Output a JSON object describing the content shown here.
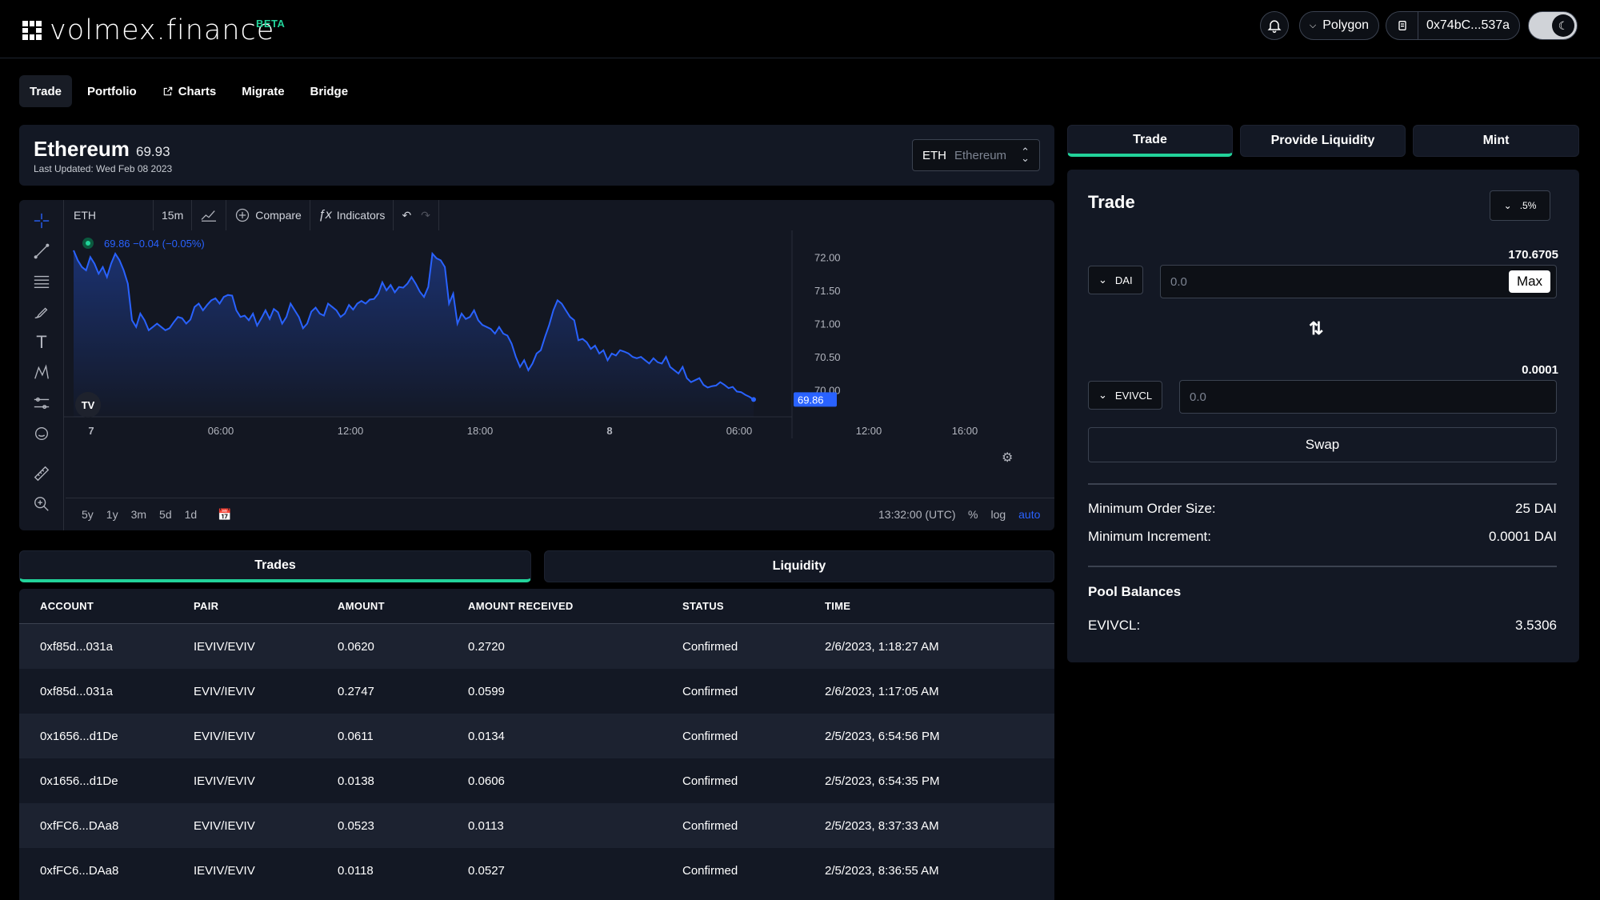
{
  "header": {
    "logo_text": "volmex.finance",
    "beta": "BETA",
    "network": "Polygon",
    "wallet": "0x74bC...537a"
  },
  "nav": [
    {
      "label": "Trade",
      "active": true
    },
    {
      "label": "Portfolio"
    },
    {
      "label": "Charts",
      "icon": "external-link-icon"
    },
    {
      "label": "Migrate"
    },
    {
      "label": "Bridge"
    }
  ],
  "asset": {
    "name": "Ethereum",
    "price": "69.93",
    "updated": "Last Updated: Wed Feb 08 2023",
    "select_symbol": "ETH",
    "select_name": "Ethereum"
  },
  "chart_toolbar": {
    "symbol": "ETH",
    "interval": "15m",
    "compare": "Compare",
    "indicators": "Indicators"
  },
  "chart_data": {
    "type": "area",
    "legend_value": "69.86",
    "legend_change": "−0.04 (−0.05%)",
    "last_label": "69.86",
    "x_ticks": [
      "7",
      "06:00",
      "12:00",
      "18:00",
      "8",
      "06:00",
      "12:00",
      "16:00"
    ],
    "y_ticks": [
      "72.00",
      "71.50",
      "71.00",
      "70.50",
      "70.00"
    ],
    "ylim": [
      69.6,
      72.4
    ],
    "values": [
      72.1,
      71.95,
      71.85,
      71.8,
      72.0,
      71.9,
      71.75,
      71.85,
      71.7,
      71.9,
      72.05,
      71.95,
      71.8,
      71.6,
      71.05,
      70.95,
      71.15,
      71.05,
      70.9,
      70.95,
      71.0,
      70.95,
      70.9,
      70.93,
      71.02,
      71.1,
      71.08,
      71.0,
      71.06,
      71.25,
      71.3,
      71.2,
      71.28,
      71.35,
      71.38,
      71.3,
      71.4,
      71.43,
      71.42,
      71.2,
      71.1,
      71.12,
      71.05,
      71.15,
      70.97,
      71.08,
      71.2,
      71.07,
      71.22,
      71.17,
      71.0,
      71.1,
      71.3,
      71.2,
      71.1,
      70.93,
      71.0,
      71.18,
      71.24,
      71.15,
      71.12,
      71.3,
      71.25,
      71.2,
      71.1,
      71.15,
      71.28,
      71.21,
      71.3,
      71.34,
      71.3,
      71.36,
      71.37,
      71.45,
      71.62,
      71.5,
      71.58,
      71.47,
      71.55,
      71.54,
      71.6,
      71.7,
      71.6,
      71.48,
      71.4,
      71.55,
      72.05,
      71.98,
      71.95,
      71.85,
      71.3,
      71.45,
      71.0,
      71.15,
      71.07,
      71.1,
      71.2,
      71.05,
      70.98,
      70.95,
      70.92,
      70.85,
      70.95,
      70.85,
      70.82,
      70.7,
      70.5,
      70.35,
      70.45,
      70.3,
      70.4,
      70.55,
      70.6,
      70.8,
      70.98,
      71.2,
      71.35,
      71.3,
      71.2,
      71.1,
      71.05,
      70.75,
      70.77,
      70.72,
      70.62,
      70.67,
      70.55,
      70.6,
      70.45,
      70.55,
      70.52,
      70.6,
      70.58,
      70.55,
      70.5,
      70.48,
      70.5,
      70.45,
      70.4,
      70.48,
      70.42,
      70.4,
      70.5,
      70.35,
      70.3,
      70.25,
      70.35,
      70.18,
      70.12,
      70.15,
      70.18,
      70.08,
      70.04,
      70.06,
      70.07,
      70.12,
      70.08,
      70.03,
      70.05,
      69.98,
      69.97,
      69.93,
      69.9,
      69.86
    ],
    "range_buttons": [
      "5y",
      "1y",
      "3m",
      "5d",
      "1d"
    ],
    "time_utc": "13:32:00 (UTC)",
    "scale_buttons": [
      "%",
      "log",
      "auto"
    ],
    "line_color": "#2962ff"
  },
  "tabs": {
    "trades": "Trades",
    "liquidity": "Liquidity"
  },
  "table": {
    "headers": [
      "ACCOUNT",
      "PAIR",
      "AMOUNT",
      "AMOUNT RECEIVED",
      "STATUS",
      "TIME"
    ],
    "rows": [
      [
        "0xf85d...031a",
        "IEVIV/EVIV",
        "0.0620",
        "0.2720",
        "Confirmed",
        "2/6/2023, 1:18:27 AM"
      ],
      [
        "0xf85d...031a",
        "EVIV/IEVIV",
        "0.2747",
        "0.0599",
        "Confirmed",
        "2/6/2023, 1:17:05 AM"
      ],
      [
        "0x1656...d1De",
        "EVIV/IEVIV",
        "0.0611",
        "0.0134",
        "Confirmed",
        "2/5/2023, 6:54:56 PM"
      ],
      [
        "0x1656...d1De",
        "IEVIV/EVIV",
        "0.0138",
        "0.0606",
        "Confirmed",
        "2/5/2023, 6:54:35 PM"
      ],
      [
        "0xfFC6...DAa8",
        "EVIV/IEVIV",
        "0.0523",
        "0.0113",
        "Confirmed",
        "2/5/2023, 8:37:33 AM"
      ],
      [
        "0xfFC6...DAa8",
        "IEVIV/EVIV",
        "0.0118",
        "0.0527",
        "Confirmed",
        "2/5/2023, 8:36:55 AM"
      ]
    ]
  },
  "right_tabs": [
    "Trade",
    "Provide Liquidity",
    "Mint"
  ],
  "trade": {
    "title": "Trade",
    "slippage": ".5%",
    "from_balance": "170.6705",
    "from_token": "DAI",
    "from_placeholder": "0.0",
    "max": "Max",
    "to_balance": "0.0001",
    "to_token": "EVIVCL",
    "to_placeholder": "0.0",
    "swap": "Swap",
    "min_order_label": "Minimum Order Size:",
    "min_order_value": "25 DAI",
    "min_inc_label": "Minimum Increment:",
    "min_inc_value": "0.0001 DAI",
    "pool_title": "Pool Balances",
    "pool_label": "EVIVCL:",
    "pool_value": "3.5306"
  },
  "colors": {
    "accent": "#22d39a",
    "chart_line": "#2962ff",
    "panel": "#131824"
  }
}
